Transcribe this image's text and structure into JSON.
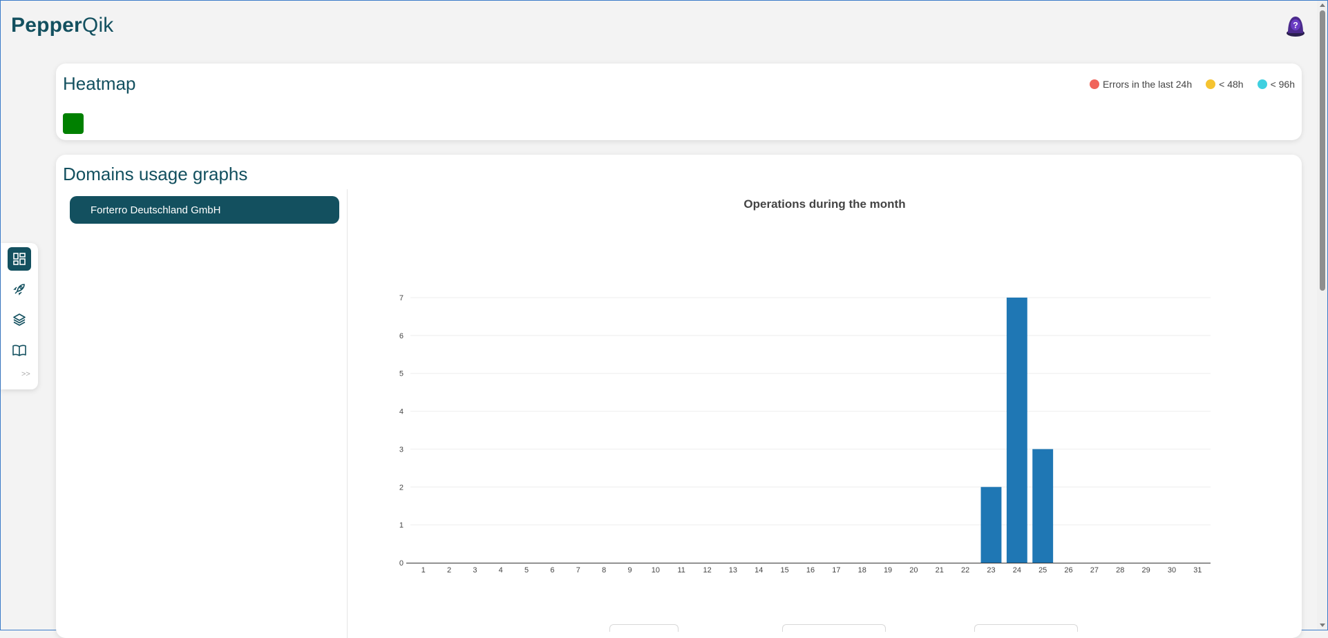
{
  "app": {
    "logo_bold": "Pepper",
    "logo_light": "Qik"
  },
  "nav": {
    "items": [
      {
        "icon": "dashboard-icon",
        "active": true
      },
      {
        "icon": "rocket-icon",
        "active": false
      },
      {
        "icon": "layers-icon",
        "active": false
      },
      {
        "icon": "book-icon",
        "active": false
      }
    ],
    "expand_label": ">>"
  },
  "heatmap": {
    "title": "Heatmap",
    "legend": [
      {
        "label": "Errors in the last 24h",
        "color": "#f0645a"
      },
      {
        "label": "< 48h",
        "color": "#f5c330"
      },
      {
        "label": "< 96h",
        "color": "#3fd0e0"
      }
    ],
    "cell_color": "#008000"
  },
  "domains": {
    "title": "Domains usage graphs",
    "items": [
      "Forterro Deutschland GmbH"
    ]
  },
  "chart_data": {
    "type": "bar",
    "title": "Operations during the month",
    "categories": [
      "1",
      "2",
      "3",
      "4",
      "5",
      "6",
      "7",
      "8",
      "9",
      "10",
      "11",
      "12",
      "13",
      "14",
      "15",
      "16",
      "17",
      "18",
      "19",
      "20",
      "21",
      "22",
      "23",
      "24",
      "25",
      "26",
      "27",
      "28",
      "29",
      "30",
      "31"
    ],
    "values": [
      0,
      0,
      0,
      0,
      0,
      0,
      0,
      0,
      0,
      0,
      0,
      0,
      0,
      0,
      0,
      0,
      0,
      0,
      0,
      0,
      0,
      0,
      2,
      7,
      3,
      0,
      0,
      0,
      0,
      0,
      0
    ],
    "yticks": [
      0,
      1,
      2,
      3,
      4,
      5,
      6,
      7
    ],
    "ylim": [
      0,
      7
    ],
    "grid": true,
    "color": "#1f77b4"
  }
}
